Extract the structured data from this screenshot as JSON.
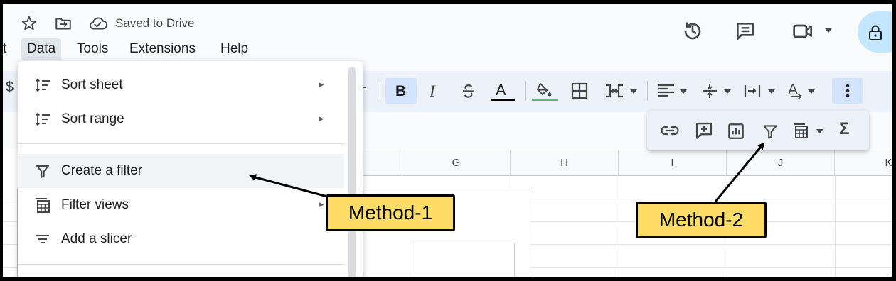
{
  "header": {
    "saved_status": "Saved to Drive",
    "icons": [
      "star-icon",
      "move-to-folder-icon",
      "cloud-done-icon",
      "history-icon",
      "comment-icon",
      "meet-icon",
      "chevron-down-icon",
      "lock-icon"
    ]
  },
  "menu_bar": {
    "items": [
      "t",
      "Data",
      "Tools",
      "Extensions",
      "Help"
    ],
    "active": "Data"
  },
  "toolbar": {
    "partial_left": "$",
    "partial_plus": "+",
    "buttons": [
      "bold",
      "italic",
      "strikethrough",
      "text-color",
      "fill-color",
      "borders",
      "merge-cells",
      "horizontal-align",
      "vertical-align",
      "text-wrapping",
      "text-rotation",
      "more"
    ],
    "accent": "#d3e3fd",
    "bold_label": "B",
    "italic_label": "I",
    "text_color_label": "A",
    "rotation_label": "A"
  },
  "overflow_toolbar": {
    "buttons": [
      "insert-link",
      "insert-comment",
      "insert-chart",
      "create-filter",
      "filter-views",
      "functions"
    ],
    "functions_label": "Σ"
  },
  "grid": {
    "columns": [
      "G",
      "H",
      "I",
      "J",
      "K"
    ]
  },
  "data_menu": {
    "items": [
      {
        "label": "Sort sheet",
        "icon": "sort-icon",
        "submenu": true
      },
      {
        "label": "Sort range",
        "icon": "sort-icon",
        "submenu": true
      },
      {
        "label": "Create a filter",
        "icon": "filter-icon",
        "submenu": false,
        "highlighted": true
      },
      {
        "label": "Filter views",
        "icon": "filter-views-icon",
        "submenu": true
      },
      {
        "label": "Add a slicer",
        "icon": "slicer-icon",
        "submenu": false
      }
    ],
    "submenu_arrow": "►"
  },
  "annotations": {
    "method_1": "Method-1",
    "method_2": "Method-2",
    "callout_color": "#ffdc66"
  }
}
